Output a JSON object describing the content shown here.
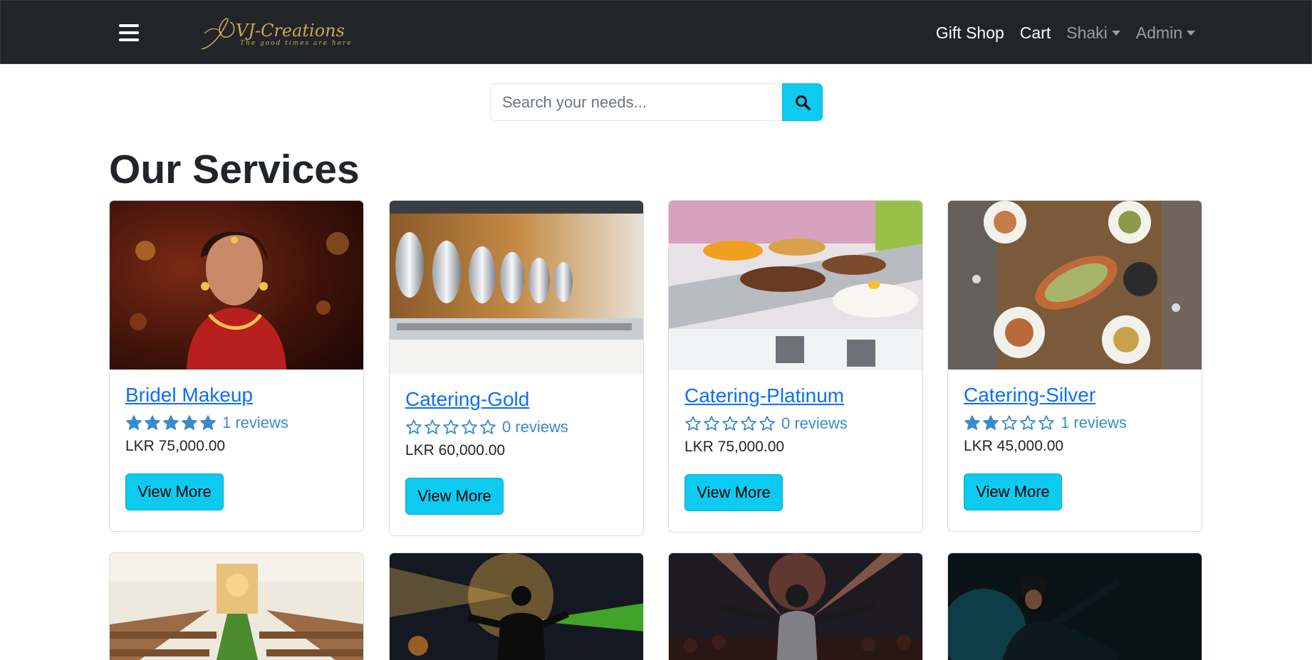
{
  "nav": {
    "logo_text": "VJ-Creations",
    "logo_tagline": "The good times are here",
    "links": [
      {
        "label": "Gift Shop"
      },
      {
        "label": "Cart"
      },
      {
        "label": "Shaki"
      },
      {
        "label": "Admin"
      }
    ]
  },
  "search": {
    "placeholder": "Search your needs...",
    "icon": "search-icon"
  },
  "page_title": "Our Services",
  "services": [
    {
      "name": "Bridel Makeup",
      "rating": 5,
      "reviews": "1 reviews",
      "price": "LKR 75,000.00",
      "button": "View More",
      "image": "bride-portrait"
    },
    {
      "name": "Catering-Gold",
      "rating": 0,
      "reviews": "0 reviews",
      "price": "LKR 60,000.00",
      "button": "View More",
      "image": "chafing-dishes"
    },
    {
      "name": "Catering-Platinum",
      "rating": 0,
      "reviews": "0 reviews",
      "price": "LKR 75,000.00",
      "button": "View More",
      "image": "buffet-table"
    },
    {
      "name": "Catering-Silver",
      "rating": 2,
      "reviews": "1 reviews",
      "price": "LKR 45,000.00",
      "button": "View More",
      "image": "dinner-platters"
    }
  ],
  "more_services_images": [
    "church-aisle",
    "dj-laser",
    "concert-crowd",
    "dj-spotlight"
  ],
  "colors": {
    "navbar": "#212529",
    "accent_button": "#0dcaf0",
    "link": "#0d6efd",
    "star": "#3a8bcb"
  }
}
